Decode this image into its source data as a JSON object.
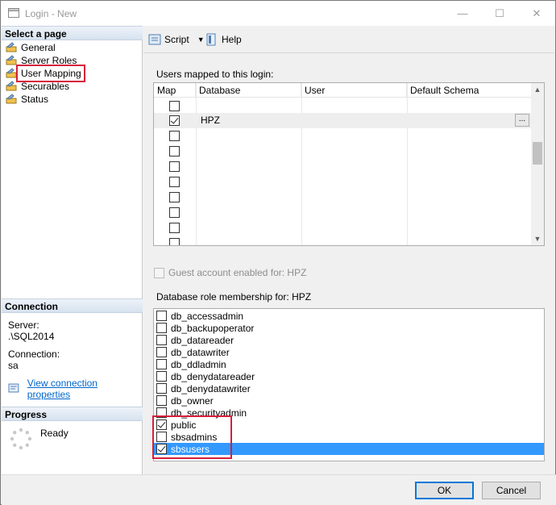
{
  "window": {
    "title": "Login - New",
    "controls": {
      "minimize": "—",
      "maximize": "☐",
      "close": "✕"
    }
  },
  "left_pane": {
    "select_page_header": "Select a page",
    "pages": [
      "General",
      "Server Roles",
      "User Mapping",
      "Securables",
      "Status"
    ],
    "connection_header": "Connection",
    "server_label": "Server:",
    "server_value": ".\\SQL2014",
    "connection_label": "Connection:",
    "connection_value": "sa",
    "view_connection_link": "View connection properties",
    "progress_header": "Progress",
    "progress_status": "Ready"
  },
  "toolbar": {
    "script_label": "Script",
    "help_label": "Help"
  },
  "users_mapped": {
    "label": "Users mapped to this login:",
    "columns": [
      "Map",
      "Database",
      "User",
      "Default Schema"
    ],
    "rows": [
      {
        "checked": false,
        "database": ""
      },
      {
        "checked": true,
        "database": "HPZ"
      },
      {
        "checked": false,
        "database": ""
      },
      {
        "checked": false,
        "database": ""
      },
      {
        "checked": false,
        "database": ""
      },
      {
        "checked": false,
        "database": ""
      },
      {
        "checked": false,
        "database": ""
      },
      {
        "checked": false,
        "database": ""
      },
      {
        "checked": false,
        "database": ""
      },
      {
        "checked": false,
        "database": ""
      }
    ],
    "ellipsis": "..."
  },
  "guest": {
    "label": "Guest account enabled for: HPZ",
    "checked": false
  },
  "roles": {
    "label": "Database role membership for: HPZ",
    "items": [
      {
        "name": "db_accessadmin",
        "checked": false
      },
      {
        "name": "db_backupoperator",
        "checked": false
      },
      {
        "name": "db_datareader",
        "checked": false
      },
      {
        "name": "db_datawriter",
        "checked": false
      },
      {
        "name": "db_ddladmin",
        "checked": false
      },
      {
        "name": "db_denydatareader",
        "checked": false
      },
      {
        "name": "db_denydatawriter",
        "checked": false
      },
      {
        "name": "db_owner",
        "checked": false
      },
      {
        "name": "db_securityadmin",
        "checked": false
      },
      {
        "name": "public",
        "checked": true
      },
      {
        "name": "sbsadmins",
        "checked": false
      },
      {
        "name": "sbsusers",
        "checked": true
      }
    ]
  },
  "buttons": {
    "ok": "OK",
    "cancel": "Cancel"
  },
  "colors": {
    "highlight_box": "#d61f3b",
    "selection": "#3399ff",
    "link": "#0066cc"
  }
}
